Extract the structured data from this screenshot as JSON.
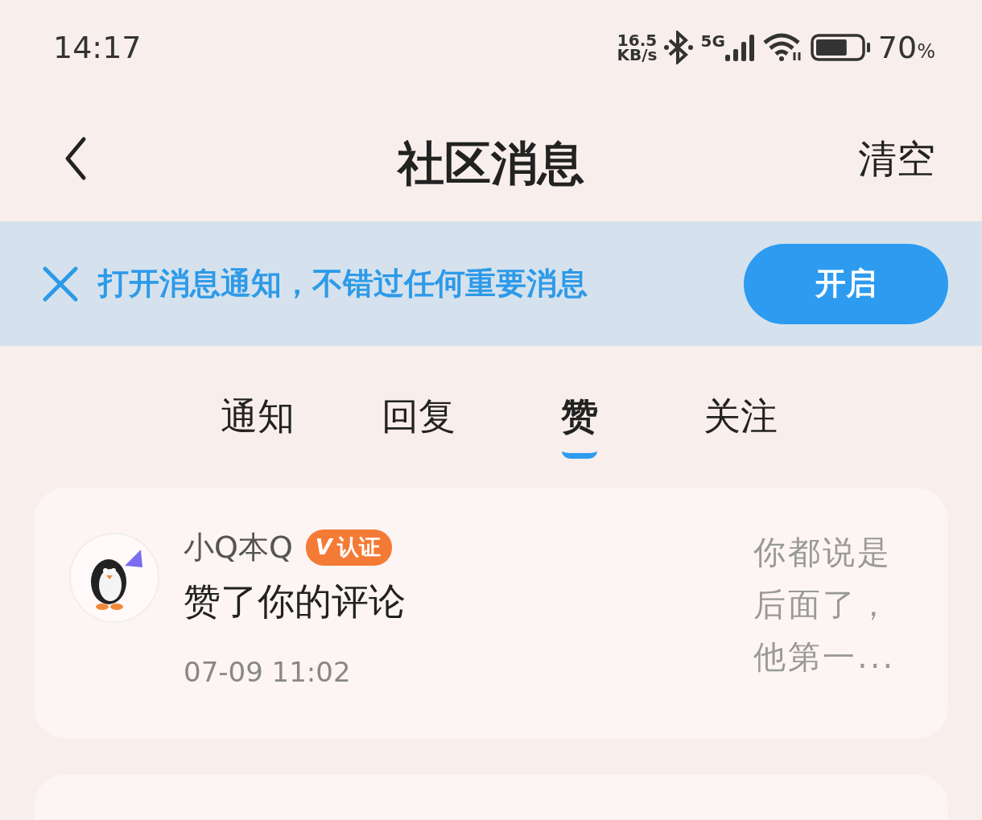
{
  "status_bar": {
    "time": "14:17",
    "net_speed_value": "16.5",
    "net_speed_unit": "KB/s",
    "network_type": "5G",
    "battery": {
      "level": 0.7,
      "text": "70",
      "unit": "%"
    }
  },
  "header": {
    "title": "社区消息",
    "action": "清空"
  },
  "notice_banner": {
    "text": "打开消息通知，不错过任何重要消息",
    "button": "开启"
  },
  "tabs": [
    {
      "label": "通知",
      "selected": false
    },
    {
      "label": "回复",
      "selected": false
    },
    {
      "label": "赞",
      "selected": true
    },
    {
      "label": "关注",
      "selected": false
    }
  ],
  "messages": [
    {
      "user": "小Q本Q",
      "badge": "认证",
      "badge_mark": "V",
      "action": "赞了你的评论",
      "time": "07-09 11:02",
      "quote": "你都说是后面了，他第一..."
    }
  ]
}
